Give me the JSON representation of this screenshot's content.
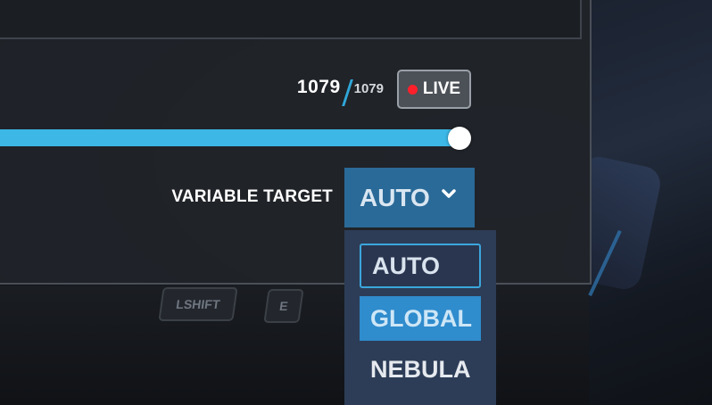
{
  "counter": {
    "current": "1079",
    "total": "1079"
  },
  "live_button": {
    "label": "LIVE",
    "indicator_color": "#ff1f2a"
  },
  "slider": {
    "value_fraction": 1.0,
    "track_color": "#3cb7e6"
  },
  "variable_target": {
    "label": "VARIABLE TARGET",
    "selected": "AUTO",
    "options": [
      "AUTO",
      "GLOBAL",
      "NEBULA"
    ],
    "highlighted": "GLOBAL"
  },
  "keys": [
    "LSHIFT",
    "E"
  ],
  "colors": {
    "accent": "#2fa7d9",
    "select_bg": "#2a6a98",
    "dropdown_bg": "#2d3d57"
  }
}
